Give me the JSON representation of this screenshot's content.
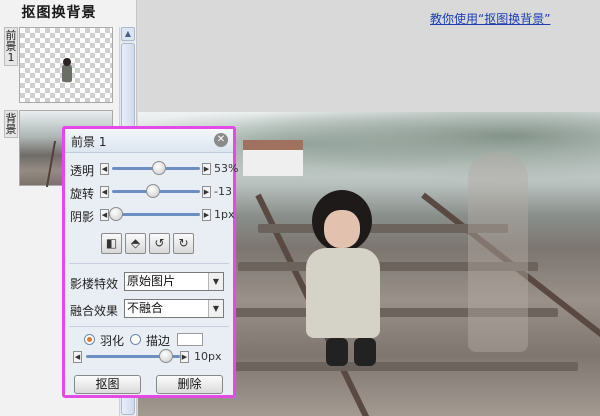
{
  "sidebar": {
    "title": "抠图换背景",
    "layers": [
      {
        "tab_top": "前",
        "tab_bottom": "景",
        "tab_num": "1"
      },
      {
        "tab_top": "背",
        "tab_bottom": "景",
        "tab_num": ""
      }
    ]
  },
  "header": {
    "help_link": "教你使用“抠图换背景”"
  },
  "panel": {
    "title": "前景 1",
    "sliders": [
      {
        "label": "透明",
        "value": "53%",
        "level": 0.53
      },
      {
        "label": "旋转",
        "value": "-13",
        "level": 0.47
      },
      {
        "label": "阴影",
        "value": "1px",
        "level": 0.05
      }
    ],
    "effect": {
      "label": "影楼特效",
      "selected": "原始图片"
    },
    "blend": {
      "label": "融合效果",
      "selected": "不融合"
    },
    "feather": {
      "label": "羽化",
      "checked": true
    },
    "stroke": {
      "label": "描边",
      "checked": false
    },
    "feather_slider": {
      "value": "10px",
      "level": 0.85
    }
  },
  "buttons": {
    "cutout": "抠图",
    "delete": "删除"
  },
  "colors": {
    "panel_border": "#e64ae6",
    "link": "#1c3fb6",
    "slider_track": "#6b8fc2"
  }
}
